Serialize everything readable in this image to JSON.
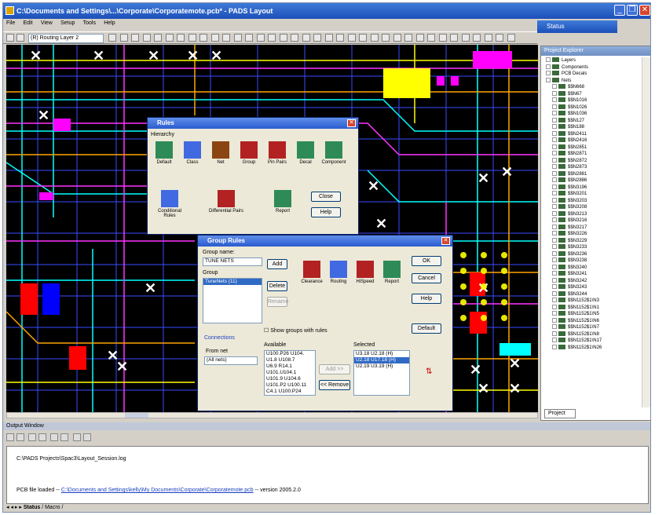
{
  "window": {
    "title": "C:\\Documents and Settings\\...\\Corporate\\Corporatemote.pcb* - PADS Layout",
    "status_label": "Status"
  },
  "menu": [
    "File",
    "Edit",
    "View",
    "Setup",
    "Tools",
    "Help"
  ],
  "toolbar": {
    "layer": "(R) Routing Layer 2"
  },
  "explorer": {
    "title": "Project Explorer",
    "tab": "Project",
    "tree": [
      "Layers",
      "Components",
      "PCB Decals",
      "Nets",
      "$$N668",
      "$$N67",
      "$$N1016",
      "$$N1026",
      "$$N1036",
      "$$N127",
      "$$N188",
      "$$N2411",
      "$$N2416",
      "$$N2851",
      "$$N2871",
      "$$N2872",
      "$$N2873",
      "$$N2881",
      "$$N2886",
      "$$N3196",
      "$$N3201",
      "$$N3203",
      "$$N3208",
      "$$N3213",
      "$$N3216",
      "$$N3217",
      "$$N3226",
      "$$N3229",
      "$$N3233",
      "$$N3236",
      "$$N3238",
      "$$N3240",
      "$$N3241",
      "$$N3242",
      "$$N3243",
      "$$N3244",
      "$$N1152$1\\N3",
      "$$N1152$1\\N1",
      "$$N1152$1\\N5",
      "$$N1152$1\\N6",
      "$$N1152$1\\N7",
      "$$N1152$1\\N8",
      "$$N1152$1\\N17",
      "$$N1152$1\\N26"
    ]
  },
  "rules_dialog": {
    "title": "Rules",
    "group_label": "Hierarchy",
    "buttons": [
      "Default",
      "Class",
      "Net",
      "Group",
      "Pin Pairs",
      "Decal",
      "Component"
    ],
    "row2": [
      "Conditional Rules",
      "Differential Pairs",
      "Report"
    ],
    "close": "Close",
    "help": "Help"
  },
  "group_dialog": {
    "title": "Group Rules",
    "group_name_label": "Group name:",
    "group_name_value": "TUNE NETS",
    "group_label": "Group",
    "group_list": [
      "TuneNets (11)"
    ],
    "add": "Add",
    "delete": "Delete",
    "rename": "Rename",
    "rules": [
      "Clearance",
      "Routing",
      "HiSpeed",
      "Report"
    ],
    "ok": "OK",
    "cancel": "Cancel",
    "help": "Help",
    "default": "Default",
    "show_groups": "Show groups with rules",
    "connections_label": "Connections",
    "from_net_label": "From net",
    "from_net_value": "(All nets)",
    "available_label": "Available",
    "available": [
      "U100.P26 U104.",
      "U1.8 U108.7",
      "U6.9 R14.1",
      "U101.U104.1",
      "U101.9 U104.6",
      "U101.P2 U100.11",
      "C4.1 U100.P24"
    ],
    "selected_label": "Selected",
    "selected": [
      "U3.18 U2.18 (H)",
      "U2.18 U17.18 (H)",
      "U2.19 U3.19 (H)"
    ],
    "add_to": "Add >>",
    "remove": "<< Remove"
  },
  "output": {
    "title": "Output Window",
    "line1": "C:\\PADS Projects\\Spac3\\Layout_Session.log",
    "line2_prefix": "PCB file loaded -- ",
    "line2_link": "C:\\Documents and Settings\\kelly\\My Documents\\Corporate\\Corporatemote.pcb",
    "line2_suffix": " -- version 2005.2.0",
    "tabs": [
      "Status",
      "Macro"
    ]
  }
}
